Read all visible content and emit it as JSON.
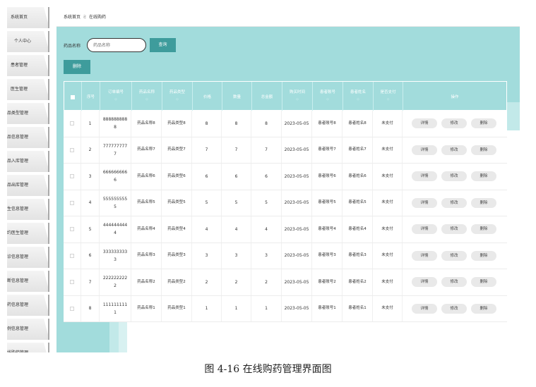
{
  "sidebar": {
    "items": [
      {
        "label": "系统首页"
      },
      {
        "label": "个人中心"
      },
      {
        "label": "患者管理"
      },
      {
        "label": "医生管理"
      },
      {
        "label": "药品类型管理"
      },
      {
        "label": "药品信息管理"
      },
      {
        "label": "药品入库管理"
      },
      {
        "label": "药品出库管理"
      },
      {
        "label": "医生信息管理"
      },
      {
        "label": "预约医生管理"
      },
      {
        "label": "就诊信息管理"
      },
      {
        "label": "诊断信息管理"
      },
      {
        "label": "开药信息管理"
      },
      {
        "label": "病例信息管理"
      },
      {
        "label": "在线购药管理"
      }
    ]
  },
  "breadcrumb": {
    "home": "系统首页",
    "separator": "ミ",
    "current": "在线购药"
  },
  "search": {
    "label": "药品名称",
    "placeholder": "药品名称",
    "query_label": "查询",
    "delete_label": "删除"
  },
  "table": {
    "columns": {
      "index": "序号",
      "order_no": "订单编号",
      "drug_name": "药品名称",
      "drug_type": "药品类型",
      "price": "价格",
      "qty": "数量",
      "total": "总金额",
      "time": "购买时间",
      "account": "患者账号",
      "patient": "患者姓名",
      "paid": "是否支付",
      "ops": "操作"
    },
    "rows": [
      {
        "index": "1",
        "order_no": "8888888888",
        "drug_name": "药品名称8",
        "drug_type": "药品类型8",
        "price": "8",
        "qty": "8",
        "total": "8",
        "time": "2023-05-05",
        "account": "患者账号8",
        "patient": "患者姓名8",
        "paid": "未支付"
      },
      {
        "index": "2",
        "order_no": "7777777777",
        "drug_name": "药品名称7",
        "drug_type": "药品类型7",
        "price": "7",
        "qty": "7",
        "total": "7",
        "time": "2023-05-05",
        "account": "患者账号7",
        "patient": "患者姓名7",
        "paid": "未支付"
      },
      {
        "index": "3",
        "order_no": "6666666666",
        "drug_name": "药品名称6",
        "drug_type": "药品类型6",
        "price": "6",
        "qty": "6",
        "total": "6",
        "time": "2023-05-05",
        "account": "患者账号6",
        "patient": "患者姓名6",
        "paid": "未支付"
      },
      {
        "index": "4",
        "order_no": "5555555555",
        "drug_name": "药品名称5",
        "drug_type": "药品类型5",
        "price": "5",
        "qty": "5",
        "total": "5",
        "time": "2023-05-05",
        "account": "患者账号5",
        "patient": "患者姓名5",
        "paid": "未支付"
      },
      {
        "index": "5",
        "order_no": "4444444444",
        "drug_name": "药品名称4",
        "drug_type": "药品类型4",
        "price": "4",
        "qty": "4",
        "total": "4",
        "time": "2023-05-05",
        "account": "患者账号4",
        "patient": "患者姓名4",
        "paid": "未支付"
      },
      {
        "index": "6",
        "order_no": "3333333333",
        "drug_name": "药品名称3",
        "drug_type": "药品类型3",
        "price": "3",
        "qty": "3",
        "total": "3",
        "time": "2023-05-05",
        "account": "患者账号3",
        "patient": "患者姓名3",
        "paid": "未支付"
      },
      {
        "index": "7",
        "order_no": "2222222222",
        "drug_name": "药品名称2",
        "drug_type": "药品类型2",
        "price": "2",
        "qty": "2",
        "total": "2",
        "time": "2023-05-05",
        "account": "患者账号2",
        "patient": "患者姓名2",
        "paid": "未支付"
      },
      {
        "index": "8",
        "order_no": "1111111111",
        "drug_name": "药品名称1",
        "drug_type": "药品类型1",
        "price": "1",
        "qty": "1",
        "total": "1",
        "time": "2023-05-05",
        "account": "患者账号1",
        "patient": "患者姓名1",
        "paid": "未支付"
      }
    ],
    "actions": {
      "detail": "详情",
      "edit": "修改",
      "delete": "删除"
    }
  },
  "caption": "图 4-16 在线购药管理界面图"
}
